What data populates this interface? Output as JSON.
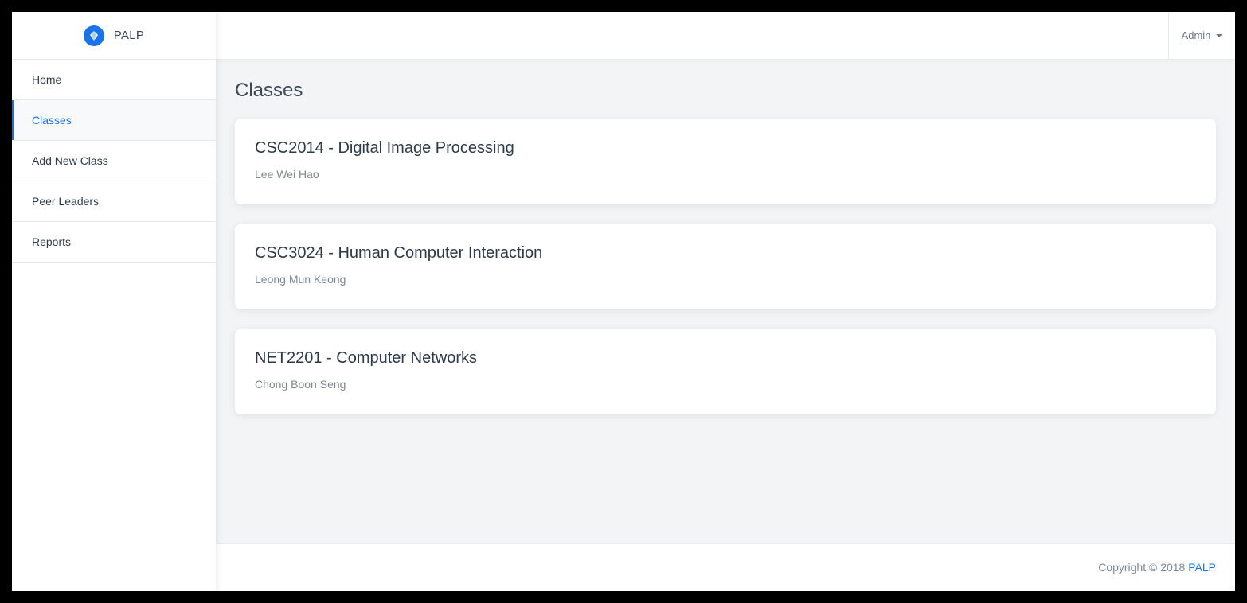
{
  "brand": {
    "name": "PALP",
    "logo_icon": "diamond-icon",
    "accent_color": "#1a73e8"
  },
  "sidebar": {
    "items": [
      {
        "label": "Home"
      },
      {
        "label": "Classes",
        "active": true
      },
      {
        "label": "Add New Class"
      },
      {
        "label": "Peer Leaders"
      },
      {
        "label": "Reports"
      }
    ]
  },
  "topbar": {
    "user_menu_label": "Admin"
  },
  "main": {
    "title": "Classes",
    "classes": [
      {
        "title": "CSC2014 - Digital Image Processing",
        "lecturer": "Lee Wei Hao"
      },
      {
        "title": "CSC3024 - Human Computer Interaction",
        "lecturer": "Leong Mun Keong"
      },
      {
        "title": "NET2201 - Computer Networks",
        "lecturer": "Chong Boon Seng"
      }
    ]
  },
  "footer": {
    "copyright_text": "Copyright © 2018 ",
    "link_text": "PALP"
  }
}
